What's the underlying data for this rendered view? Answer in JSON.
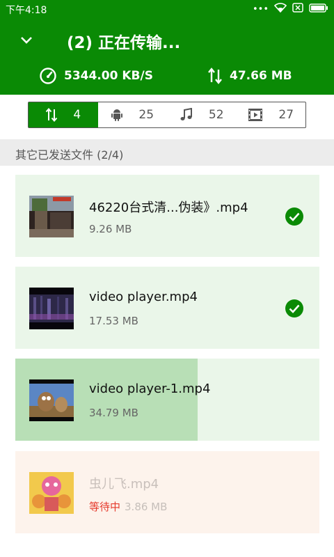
{
  "status_bar": {
    "time": "下午4:18",
    "dots": "•••"
  },
  "header": {
    "title": "(2) 正在传输...",
    "speed": "5344.00 KB/S",
    "total_size": "47.66 MB"
  },
  "tabs": [
    {
      "icon": "transfer-icon",
      "count": "4",
      "active": true
    },
    {
      "icon": "android-icon",
      "count": "25",
      "active": false
    },
    {
      "icon": "music-icon",
      "count": "52",
      "active": false
    },
    {
      "icon": "video-icon",
      "count": "27",
      "active": false
    }
  ],
  "section": {
    "title": "其它已发送文件 (2/4)"
  },
  "files": [
    {
      "name": "46220台式清...伪装》.mp4",
      "size": "9.26 MB",
      "status": "done"
    },
    {
      "name": "video player.mp4",
      "size": "17.53 MB",
      "status": "done"
    },
    {
      "name": "video player-1.mp4",
      "size": "34.79 MB",
      "status": "transferring",
      "progress": 0.6
    },
    {
      "name": "虫儿飞.mp4",
      "size": "3.86 MB",
      "status": "waiting",
      "status_label": "等待中"
    }
  ],
  "colors": {
    "primary": "#0a8a05",
    "done_card": "#eaf6e9",
    "progress": "#b8dfb6",
    "waiting_card": "#fdf3ec",
    "waiting_text": "#e53a2c"
  }
}
